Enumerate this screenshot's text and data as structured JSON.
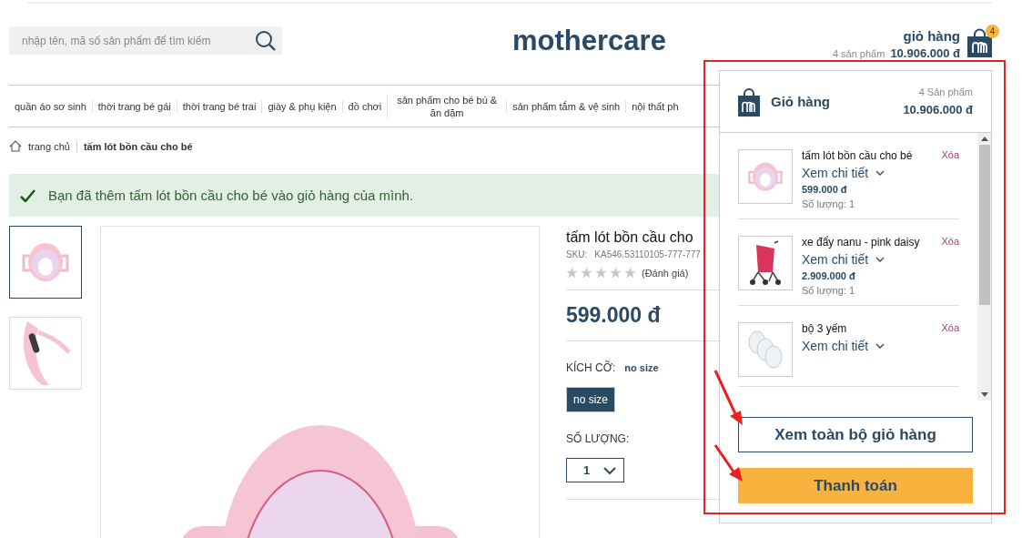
{
  "header": {
    "search": {
      "placeholder": "nhập tên, mã số sản phẩm để tìm kiếm"
    },
    "logo": "mothercare",
    "cart": {
      "title": "giỏ hàng",
      "count_label": "4 sản phẩm",
      "total": "10.906.000 đ",
      "badge": "4"
    }
  },
  "nav": [
    "quần áo sơ sinh",
    "thời trang bé gái",
    "thời trang bé trai",
    "giày & phụ kiện",
    "đồ chơi",
    "sản phẩm cho bé bú & ăn dặm",
    "sản phẩm tắm & vệ sinh",
    "nội thất ph"
  ],
  "breadcrumb": [
    "trang chủ",
    "tấm lót bồn cầu cho bé"
  ],
  "alert": "Bạn đã thêm tấm lót bồn cầu cho bé vào giỏ hàng của mình.",
  "thumbnails": [
    {
      "kind": "seat",
      "selected": true
    },
    {
      "kind": "side",
      "selected": false
    }
  ],
  "product": {
    "title": "tấm lót bồn cầu cho",
    "sku_label": "SKU:",
    "sku": "KA546.53110105-777-777",
    "stars": 0,
    "rating_link": "(Đánh giá)",
    "price": "599.000 đ",
    "size_label": "KÍCH CỠ:",
    "size_value": "no size",
    "sizes": [
      {
        "label": "no size",
        "selected": true
      }
    ],
    "quantity_label": "SỐ LƯỢNG:",
    "quantity": "1"
  },
  "cart_dropdown": {
    "title": "Giỏ hàng",
    "count_label": "4 Sản phẩm",
    "total": "10.906.000 đ",
    "items": [
      {
        "kind": "seat",
        "name": "tấm lót bồn cầu cho bé",
        "remove": "Xóa",
        "details": "Xem chi tiết",
        "price": "599.000 đ",
        "quantity": "Số lượng: 1"
      },
      {
        "kind": "stroller",
        "name": "xe đẩy nanu - pink daisy",
        "remove": "Xóa",
        "details": "Xem chi tiết",
        "price": "2.909.000 đ",
        "quantity": "Số lượng: 1"
      },
      {
        "kind": "bibs",
        "name": "bộ 3 yếm",
        "remove": "Xóa",
        "details": "Xem chi tiết"
      }
    ],
    "view_cart": "Xem toàn bộ giỏ hàng",
    "checkout": "Thanh toán"
  }
}
